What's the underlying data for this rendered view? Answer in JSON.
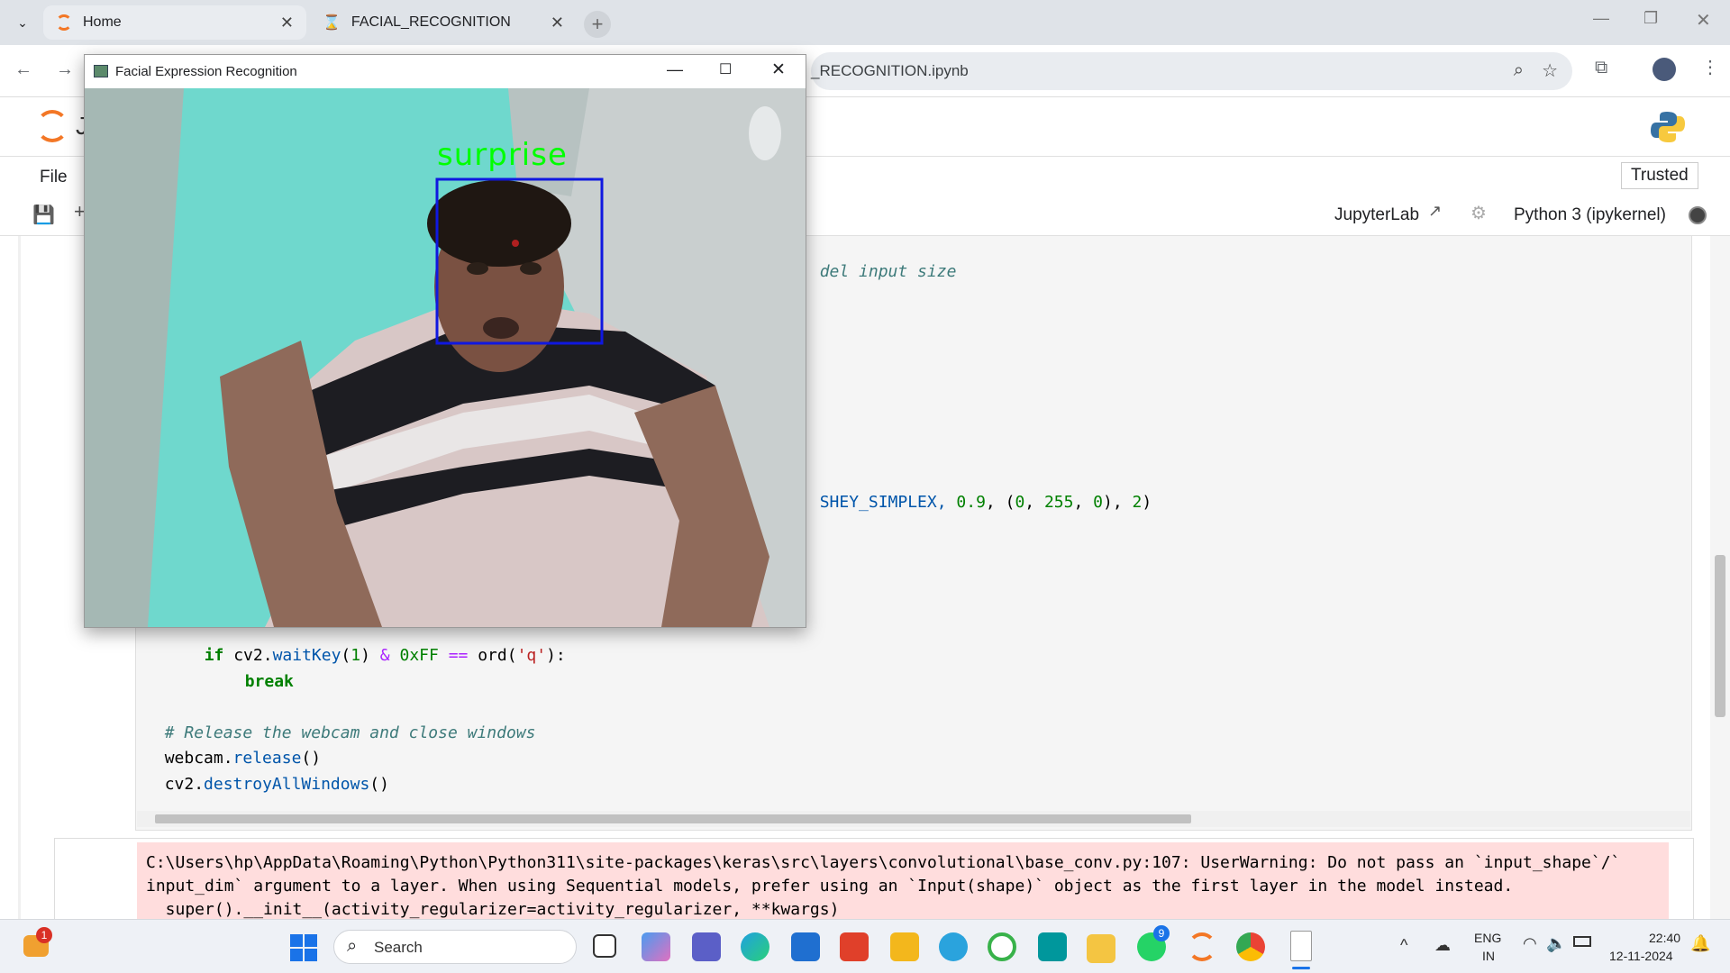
{
  "browser": {
    "tabs": [
      {
        "label": "Home",
        "active": false
      },
      {
        "label": "FACIAL_RECOGNITION",
        "active": true
      }
    ],
    "url_visible": "_RECOGNITION.ipynb"
  },
  "jupyter": {
    "logo_letter": "J",
    "menu": [
      "File"
    ],
    "trusted_label": "Trusted",
    "jupyterlab_label": "JupyterLab",
    "kernel_label": "Python 3 (ipykernel)"
  },
  "code_lines": {
    "l1": "del input size",
    "l2a": "SHEY_SIMPLEX, ",
    "l2b": "0.9",
    "l2c": ", (",
    "l2d": "0",
    "l2e": ", ",
    "l2f": "255",
    "l2g": ", ",
    "l2h": "0",
    "l2i": "), ",
    "l2j": "2",
    "l2k": ")",
    "l3_if": "if",
    "l3_a": " cv2.",
    "l3_fn": "waitKey",
    "l3_b": "(",
    "l3_n1": "1",
    "l3_c": ") ",
    "l3_amp": "&",
    "l3_d": " ",
    "l3_n2": "0xFF",
    "l3_e": " ",
    "l3_eq": "==",
    "l3_f": " ord(",
    "l3_str": "'q'",
    "l3_g": "):",
    "l4": "break",
    "l5": "# Release the webcam and close windows",
    "l6a": "webcam.",
    "l6b": "release",
    "l6c": "()",
    "l7a": "cv2.",
    "l7b": "destroyAllWindows",
    "l7c": "()"
  },
  "output_lines": [
    "C:\\Users\\hp\\AppData\\Roaming\\Python\\Python311\\site-packages\\keras\\src\\layers\\convolutional\\base_conv.py:107: UserWarning: Do not pass an `input_shape`/`",
    "input_dim` argument to a layer. When using Sequential models, prefer using an `Input(shape)` object as the first layer in the model instead.",
    "  super().__init__(activity_regularizer=activity_regularizer, **kwargs)"
  ],
  "cv_window": {
    "title": "Facial Expression Recognition",
    "label": "surprise"
  },
  "taskbar": {
    "search_placeholder": "Search",
    "lang_line1": "ENG",
    "lang_line2": "IN",
    "time": "22:40",
    "date": "12-11-2024",
    "badge_widgets": "1",
    "badge_whatsapp": "9"
  }
}
